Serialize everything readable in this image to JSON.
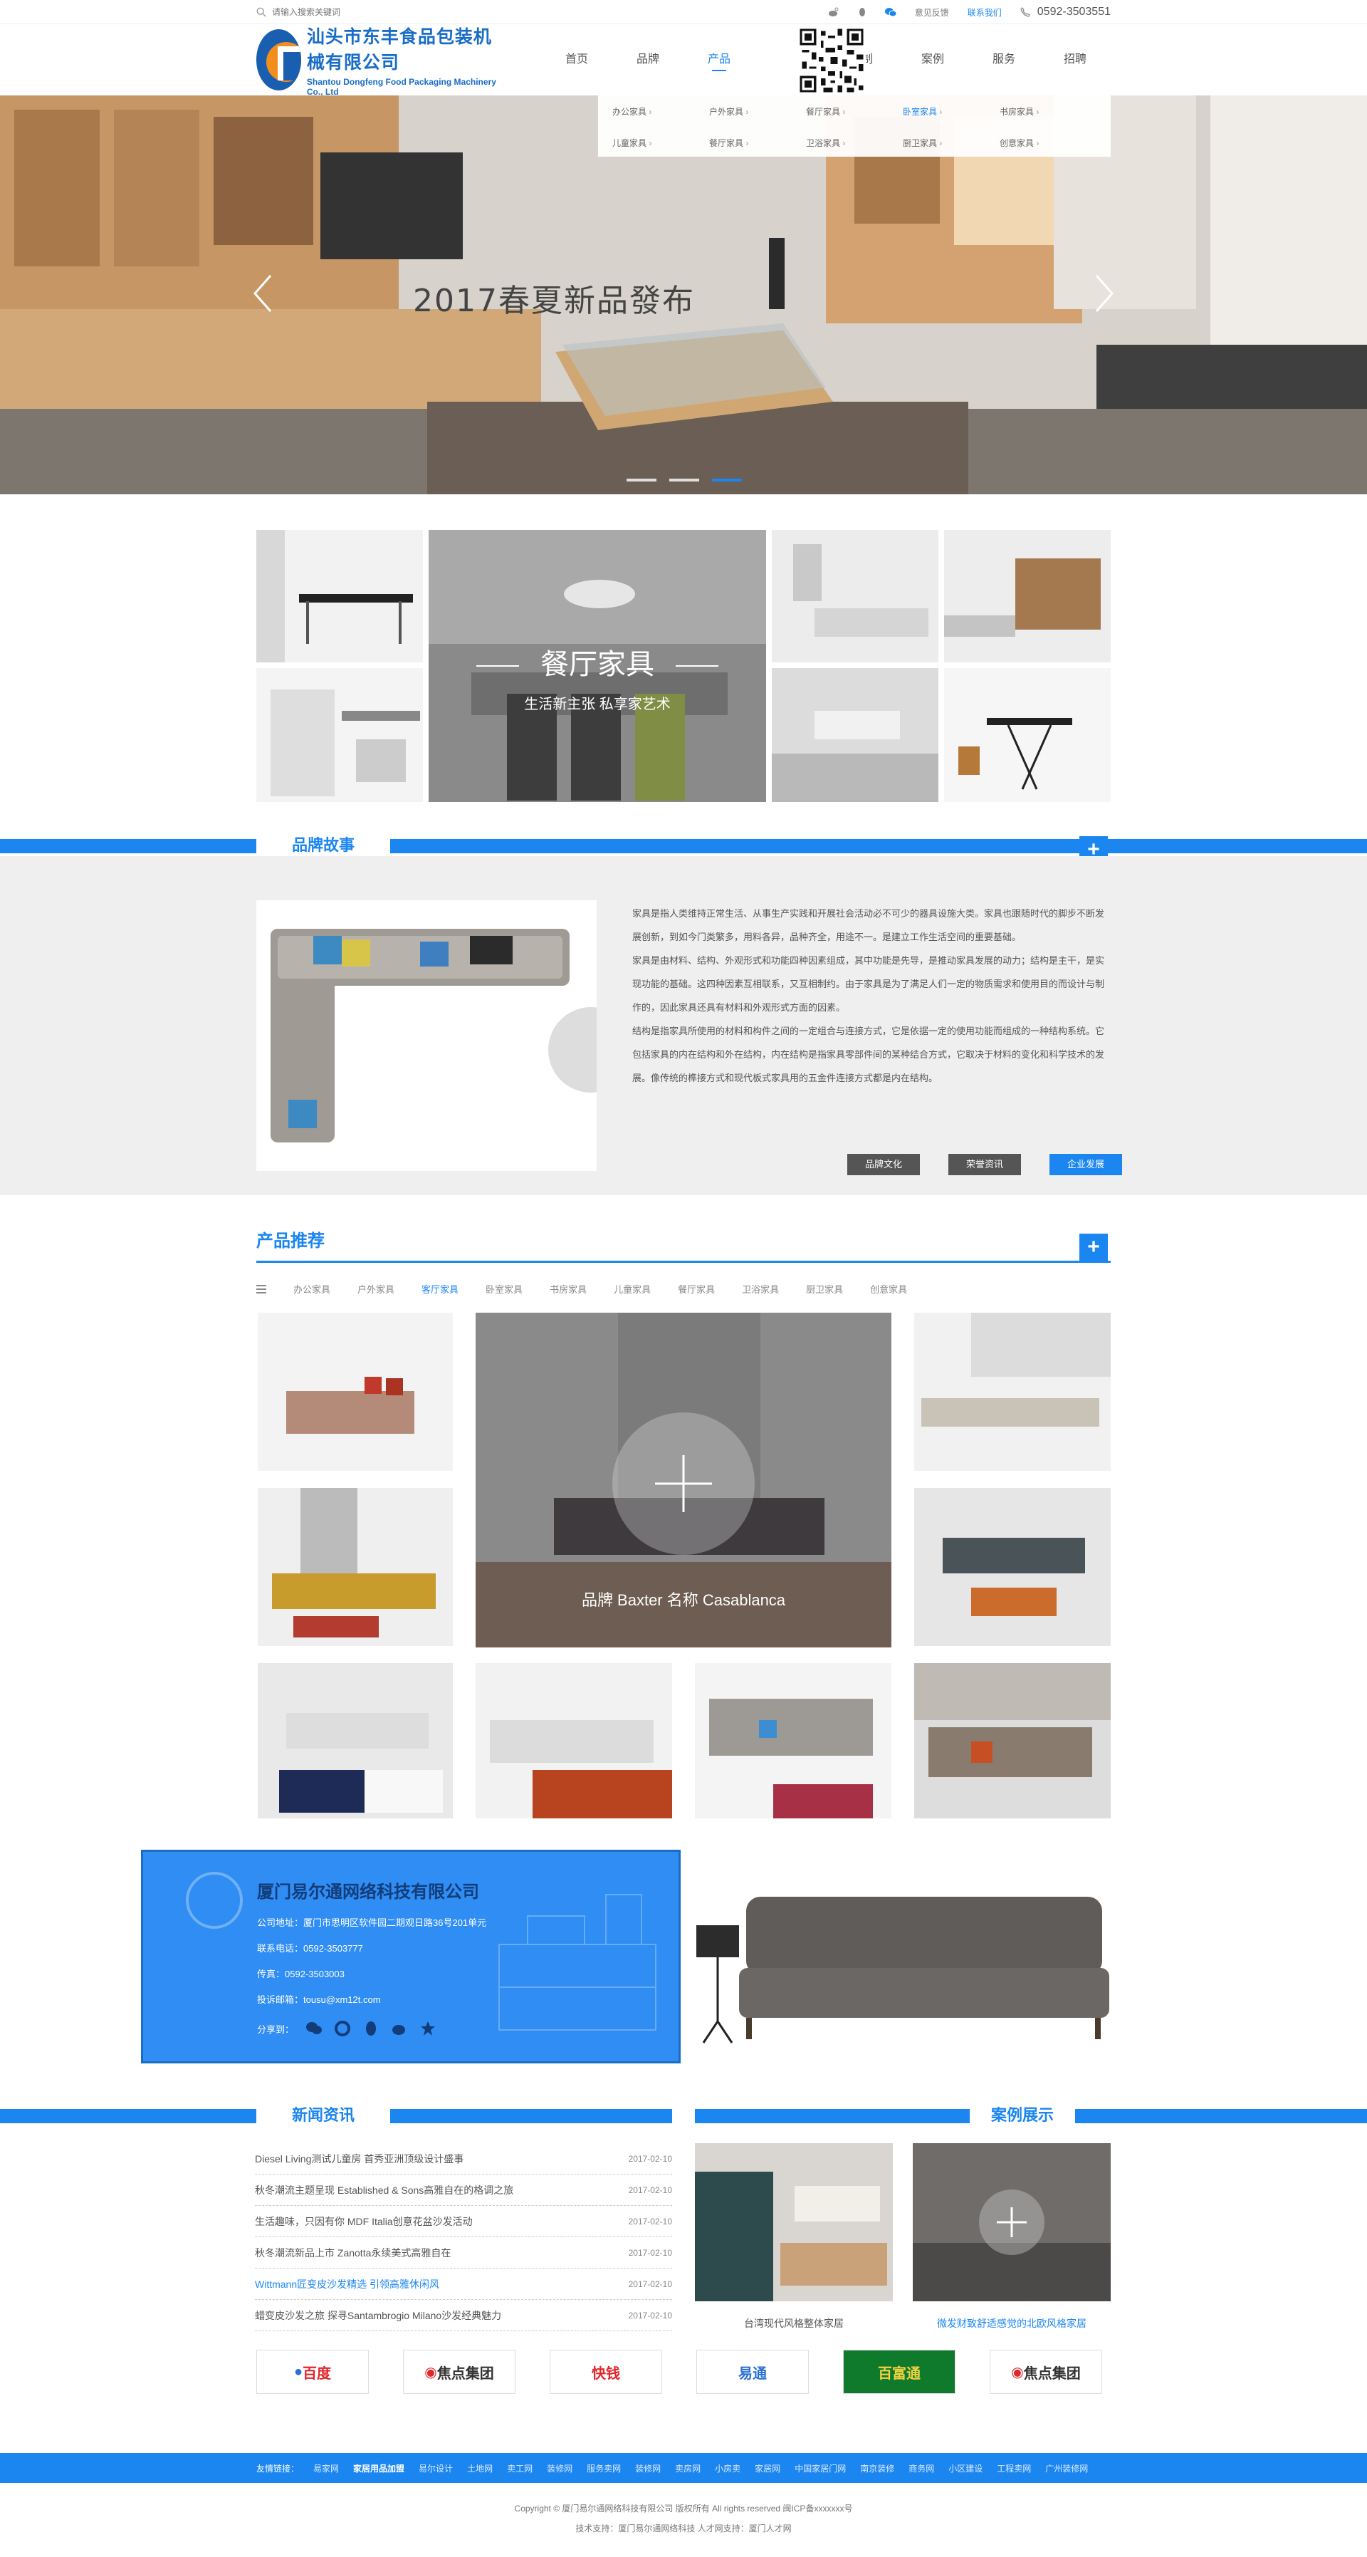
{
  "topbar": {
    "search_placeholder": "请输入搜索关键词",
    "links": [
      "意见反馈",
      "联系我们"
    ],
    "phone": "0592-3503551",
    "icons": [
      "weibo-icon",
      "qq-icon",
      "wechat-icon"
    ]
  },
  "header": {
    "company_cn": "汕头市东丰食品包装机械有限公司",
    "company_en": "Shantou Dongfeng Food Packaging Machinery Co., Ltd",
    "nav": [
      "首页",
      "品牌",
      "产品",
      "定制",
      "案例",
      "服务",
      "招聘"
    ],
    "nav_active": 2
  },
  "dropdown": {
    "items": [
      "办公家具",
      "户外家具",
      "餐厅家具",
      "卧室家具",
      "书房家具",
      "儿童家具",
      "餐厅家具",
      "卫浴家具",
      "厨卫家具",
      "创意家具"
    ],
    "selected": 3
  },
  "banner": {
    "title": "2017春夏新品發布",
    "slides": 3,
    "active_slide": 2
  },
  "mosaic": {
    "title": "餐厅家具",
    "subtitle": "生活新主张 私享家艺术"
  },
  "brand": {
    "section_title": "品牌故事",
    "paragraphs": [
      "家具是指人类维持正常生活、从事生产实践和开展社会活动必不可少的器具设施大类。家具也跟随时代的脚步不断发展创新，到如今门类繁多，用料各异，品种齐全，用途不一。是建立工作生活空间的重要基础。",
      "家具是由材料、结构、外观形式和功能四种因素组成，其中功能是先导，是推动家具发展的动力；结构是主干，是实现功能的基础。这四种因素互相联系，又互相制约。由于家具是为了满足人们一定的物质需求和使用目的而设计与制作的，因此家具还具有材料和外观形式方面的因素。",
      "结构是指家具所使用的材料和构件之间的一定组合与连接方式，它是依据一定的使用功能而组成的一种结构系统。它包括家具的内在结构和外在结构，内在结构是指家具零部件间的某种结合方式，它取决于材料的变化和科学技术的发展。像传统的榫接方式和现代板式家具用的五金件连接方式都是内在结构。"
    ],
    "buttons": [
      "品牌文化",
      "荣誉资讯",
      "企业发展"
    ]
  },
  "products": {
    "section_title": "产品推荐",
    "tabs": [
      "办公家具",
      "户外家具",
      "客厅家具",
      "卧室家具",
      "书房家具",
      "儿童家具",
      "餐厅家具",
      "卫浴家具",
      "厨卫家具",
      "创意家具"
    ],
    "tab_selected": 2,
    "featured_caption": "品牌 Baxter   名称 Casablanca"
  },
  "contact": {
    "company": "厦门易尔通网络科技有限公司",
    "lines": [
      "公司地址：厦门市思明区软件园二期观日路36号201单元",
      "联系电话：0592-3503777",
      "传真：0592-3503003",
      "投诉邮箱：tousu@xm12t.com"
    ],
    "share_label": "分享到：",
    "share_icons": [
      "wechat-icon",
      "moments-icon",
      "qq-icon",
      "weibo-icon",
      "star-icon"
    ]
  },
  "news": {
    "section_title": "新闻资讯",
    "items": [
      {
        "title": "Diesel Living测试儿童房 首秀亚洲顶级设计盛事",
        "date": "2017-02-10"
      },
      {
        "title": "秋冬潮流主题呈现 Established & Sons高雅自在的格调之旅",
        "date": "2017-02-10"
      },
      {
        "title": "生活趣味，只因有你 MDF Italia创意花盆沙发活动",
        "date": "2017-02-10"
      },
      {
        "title": "秋冬潮流新品上市 Zanotta永续美式高雅自在",
        "date": "2017-02-10"
      },
      {
        "title": "Wittmann匠变皮沙发精选 引领高雅休闲风",
        "date": "2017-02-10"
      },
      {
        "title": "蜡变皮沙发之旅 探寻Santambrogio Milano沙发经典魅力",
        "date": "2017-02-10"
      }
    ],
    "highlight": 4
  },
  "cases": {
    "section_title": "案例展示",
    "items": [
      "台湾现代风格整体家居",
      "微发财致舒适感觉的北欧风格家居"
    ]
  },
  "partners": [
    "百度",
    "焦点集团",
    "快钱",
    "易通",
    "百富通",
    "焦点集团"
  ],
  "footer": {
    "links_label": "友情链接：",
    "links": [
      "易家网",
      "家居用品加盟",
      "易尔设计",
      "土地网",
      "卖工网",
      "装修网",
      "服务卖网",
      "装修网",
      "卖房网",
      "小房卖",
      "家居网",
      "中国家居门网",
      "南京装修",
      "商务网",
      "小区建设",
      "工程卖网",
      "广州装修网"
    ],
    "copyright": "Copyright © 厦门易尔通网络科技有限公司  版权所有   All rights reserved  闽ICP备xxxxxxx号",
    "support": "技术支持：厦门易尔通网络科技  人才网支持：厦门人才网"
  },
  "colors": {
    "accent": "#1b86f0",
    "brand_bg": "#efefef",
    "logo_blue": "#1a5eb0",
    "logo_orange": "#f28e1c"
  }
}
